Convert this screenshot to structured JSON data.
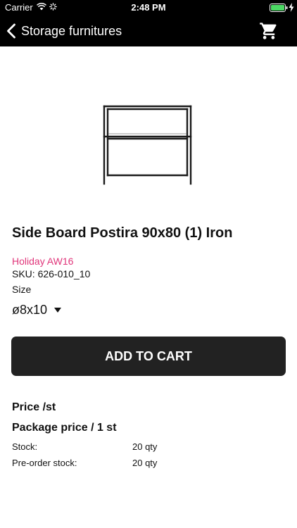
{
  "status_bar": {
    "carrier": "Carrier",
    "time": "2:48 PM",
    "icons": [
      "wifi-icon",
      "activity-icon",
      "battery-icon",
      "charging-icon"
    ],
    "battery_color": "#4cd964"
  },
  "nav": {
    "back_icon": "chevron-left-icon",
    "title": "Storage furnitures",
    "cart_icon": "cart-icon"
  },
  "product": {
    "image": "shelf-image",
    "title": "Side Board Postira 90x80 (1) Iron",
    "collection": "Holiday AW16",
    "sku": "SKU: 626-010_10",
    "size_label": "Size",
    "size_value": "ø8x10"
  },
  "actions": {
    "add_to_cart": "ADD TO CART"
  },
  "pricing": {
    "price_label": "Price /st",
    "package_price": "Package price / 1 st",
    "rows": [
      {
        "label": "Stock:",
        "value": "20 qty"
      },
      {
        "label": "Pre-order stock:",
        "value": "20 qty"
      }
    ]
  },
  "colors": {
    "header_bg": "#000000",
    "button_bg": "#222222",
    "collection_accent": "#e0357a"
  }
}
